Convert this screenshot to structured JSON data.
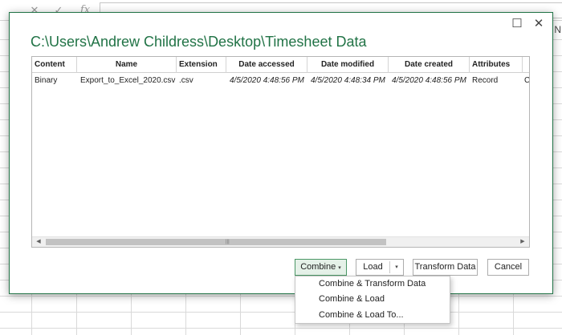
{
  "formula_bar": {
    "cancel_glyph": "✕",
    "enter_glyph": "✓",
    "function_glyph": "fx"
  },
  "background": {
    "partial_column_letter": "N"
  },
  "dialog": {
    "title": "C:\\Users\\Andrew Childress\\Desktop\\Timesheet Data",
    "maximize_glyph": "☐",
    "close_glyph": "✕"
  },
  "table": {
    "columns": [
      "Content",
      "Name",
      "Extension",
      "Date accessed",
      "Date modified",
      "Date created",
      "Attributes"
    ],
    "rows": [
      [
        "Binary",
        "Export_to_Excel_2020.csv",
        ".csv",
        "4/5/2020 4:48:56 PM",
        "4/5/2020 4:48:34 PM",
        "4/5/2020 4:48:56 PM",
        "Record"
      ]
    ],
    "overflow_cell": "C"
  },
  "scrollbar": {
    "left_arrow": "◀",
    "right_arrow": "▶",
    "grip": "|||"
  },
  "buttons": {
    "combine": "Combine",
    "combine_caret": "▾",
    "load": "Load",
    "load_caret": "▾",
    "transform": "Transform Data",
    "cancel": "Cancel"
  },
  "combine_menu": {
    "items": [
      "Combine & Transform Data",
      "Combine & Load",
      "Combine & Load To..."
    ]
  },
  "colors": {
    "accent": "#217346",
    "combine_active_bg": "#e5f1e8"
  }
}
